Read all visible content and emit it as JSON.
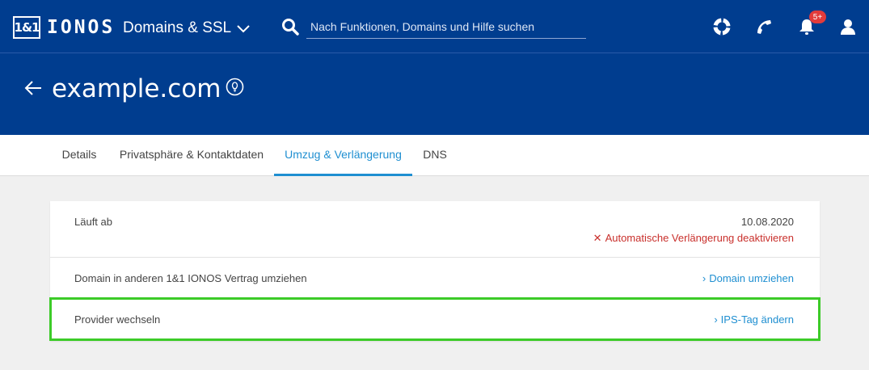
{
  "brand": {
    "logo_mark": "1&1",
    "logo_text": "IONOS"
  },
  "topbar": {
    "product": "Domains & SSL",
    "search_placeholder": "Nach Funktionen, Domains und Hilfe suchen",
    "notification_badge": "5+",
    "icons": [
      "lifebuoy-icon",
      "phone-icon",
      "bell-icon",
      "user-icon"
    ]
  },
  "header": {
    "domain": "example.com"
  },
  "tabs": [
    {
      "label": "Details",
      "active": false
    },
    {
      "label": "Privatsphäre & Kontaktdaten",
      "active": false
    },
    {
      "label": "Umzug & Verlängerung",
      "active": true
    },
    {
      "label": "DNS",
      "active": false
    }
  ],
  "rows": {
    "expires": {
      "label": "Läuft ab",
      "date": "10.08.2020",
      "action": "Automatische Verlängerung deaktivieren"
    },
    "transfer_internal": {
      "label": "Domain in anderen 1&1 IONOS Vertrag umziehen",
      "action": "Domain umziehen"
    },
    "provider_change": {
      "label": "Provider wechseln",
      "action": "IPS-Tag ändern"
    }
  },
  "colors": {
    "brand_blue": "#003d8f",
    "link_blue": "#1f8fd1",
    "danger_red": "#c9302c",
    "highlight_green": "#3ccb28"
  }
}
